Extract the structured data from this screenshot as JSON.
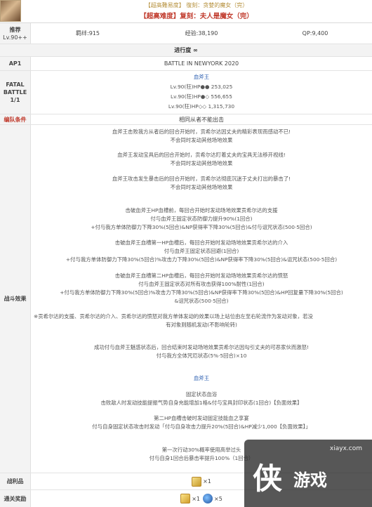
{
  "header": {
    "subtitle": "【超高難易度】 復刻：贪婪的魔女（完）",
    "title": "【超高难度】复刻：夫人是魔女（完）"
  },
  "info": {
    "recommend_label": "推荐",
    "recommend_level": "Lv.90++",
    "bond": "羁绊:915",
    "exp": "经验:38,190",
    "qp": "QP:9,400"
  },
  "progress": {
    "label": "进行度 ∞"
  },
  "ap": {
    "label": "AP1",
    "location": "BATTLE IN NEWYORK 2020"
  },
  "fatal": {
    "label_1": "FATAL",
    "label_2": "BATTLE",
    "label_3": "1/1",
    "enemy_name": "血斧王",
    "enemies": [
      "Lv.90(狂)HP●● 253,025",
      "Lv.90(狂)HP●◇ 556,655",
      "Lv.90(狂)HP◇◇ 1,315,730"
    ]
  },
  "formation": {
    "label": "编队条件",
    "value": "相同从者不能出击"
  },
  "effects": {
    "label": "战斗效果",
    "lines": [
      "血斧王击败我方从者后的回合开始时，贡希尔达因丈夫的精彩表现而感动不已!",
      "不会同时发动其他场地效果",
      "血斧王发动宝具后的回合开始时，贡希尔达盯着丈夫的宝具无法移开视线!",
      "不会同时发动其他场地效果",
      "血斧王攻击发生暴击后的回合开始时，贡希尔达彻底沉迷于丈夫打出的暴击了!",
      "不会同时发动其他场地效果",
      "击破血斧王HP血槽前，每回合开始时发动场地效果贡希尔达的支援",
      "付与血斧王固定状态防御力提升90%(1回合)",
      "+付与我方单体防御力下降30%(5回合)&NP获得率下降30%(5回合)&付与诅咒状态(500·5回合)",
      "击破血斧王血槽第一HP血槽后，每回合开始时发动场地效果贡希尔达的介入",
      "付与血斧王固定状态回避(1回合)",
      "+付与我方单体防御力下降30%(5回合)%攻击力下降30%(5回合)&NP获得率下降30%(5回合)&诅咒状态(500·5回合)",
      "击破血斧王血槽第二HP血槽后，每回合开始时发动场地效果贡希尔达的愤怒",
      "付与血斧王固定状态对所有攻击获得100%耐性(1回合)",
      "+付与我方单体防御力下降30%(5回合)%攻击力下降30%(5回合)&NP获得率下降30%(5回合)&HP回复量下降30%(5回合)",
      "&诅咒状态(500·5回合)",
      "※贡希尔达的支援、贡希尔达的介入、贡希尔达的愤怒对我方单体发动的效果以场上站位由左至右轮流作为发动对象，若没",
      "有对象则随机发动(不影响轮转)",
      "成功付与血斧王魅惑状态后，回合结束时发动场地效果贡希尔达因勾引丈夫的可恶家伙而激怒!",
      "付与我方全体咒厄状态(5%·5回合)×10",
      "血斧王",
      "固定状态血浴",
      "击败敌人时发动技能提振气势自身充能增加1格&付与宝具封印状态(1回合)【负面效果】",
      "第二HP血槽击破时发动固定技能血之享宴",
      "付与自身固定状态攻击时发动「付与自身攻击力提升20%(5回合)&HP减少1,000【负面效果】」",
      "第一次行动30%概率使用高举过头",
      "付与自身1回合后暴击率提升100%（1回合）"
    ]
  },
  "drop": {
    "label": "战利品",
    "count": "×1",
    "icon": "gold-statue-icon"
  },
  "reward": {
    "label": "通关奖励",
    "count1": "×1",
    "count2": "×5",
    "icon1": "gold-bars-icon",
    "icon2": "blue-feather-icon"
  },
  "watermark": {
    "site": "xiayx.com",
    "big": "侠",
    "small": "游戏"
  }
}
